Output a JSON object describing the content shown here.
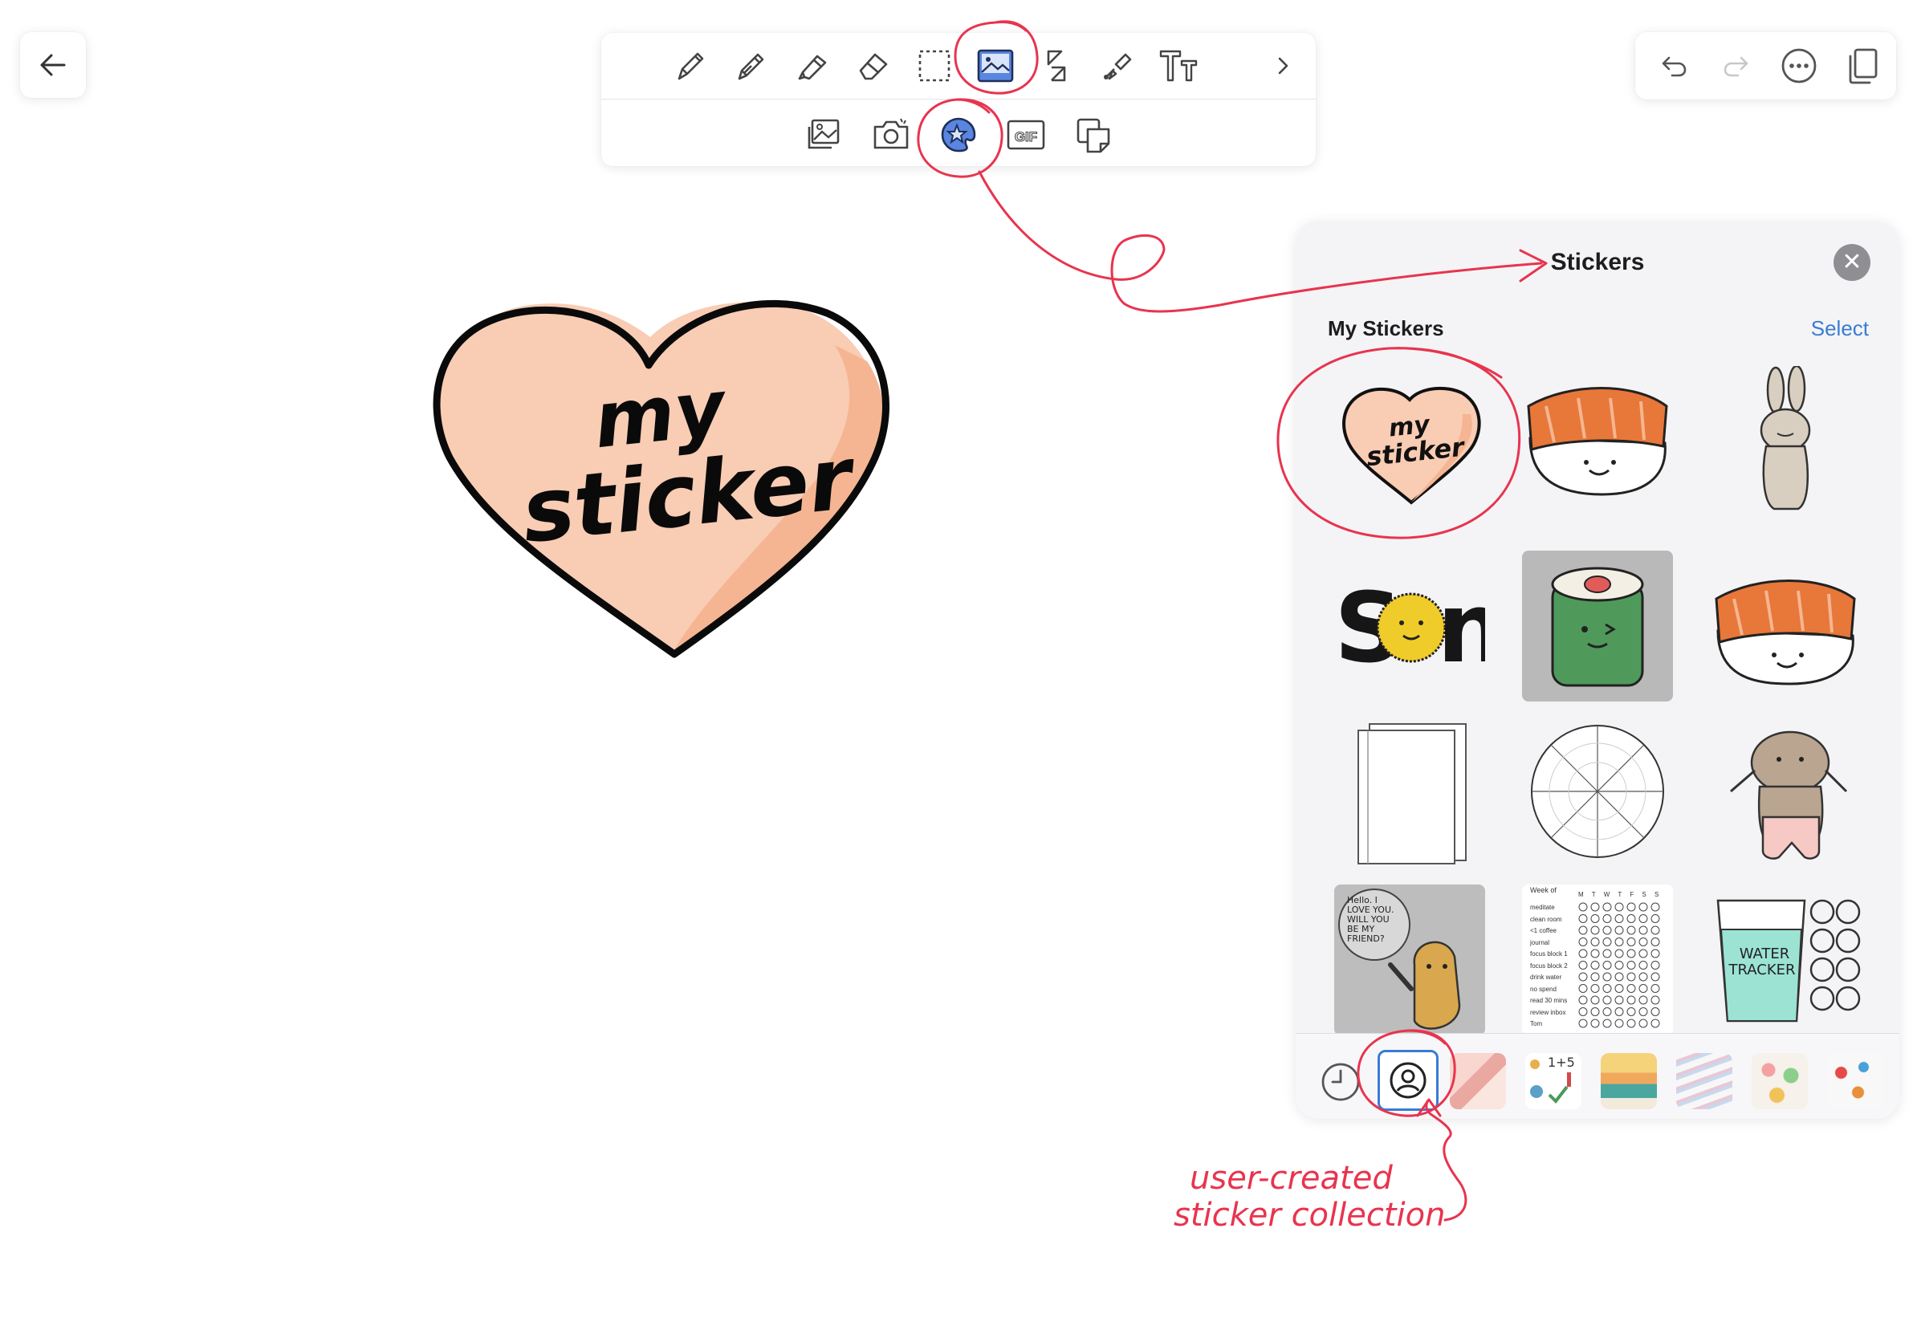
{
  "panel": {
    "title": "Stickers",
    "section_label": "My Stickers",
    "select_label": "Select"
  },
  "canvas_sticker": {
    "line1": "my",
    "line2": "sticker"
  },
  "grid_stickers": {
    "heart_line1": "my",
    "heart_line2": "sticker",
    "sun_text_left": "S",
    "sun_text_right": "n",
    "note_text_lines": [
      "Hello. I",
      "LOVE YOU.",
      "WILL YOU",
      "BE MY",
      "FRIEND?"
    ],
    "water_line1": "WATER",
    "water_line2": "TRACKER",
    "habit_header": "Week of",
    "habit_rows": [
      "meditate",
      "clean room",
      "<1 coffee",
      "journal",
      "focus block 1",
      "focus block 2",
      "drink water",
      "no spend",
      "read 30 mins",
      "review inbox",
      "Tom"
    ],
    "habit_days": "M T W T F S S",
    "pack_numbers": "1+5"
  },
  "annotations": {
    "caption_line1": "user-created",
    "caption_line2": "sticker collection"
  },
  "colors": {
    "annotation_red": "#e8344e",
    "accent_blue": "#3a7bd5",
    "heart_peach": "#f9ccb4",
    "heart_shade": "#f5b592"
  }
}
